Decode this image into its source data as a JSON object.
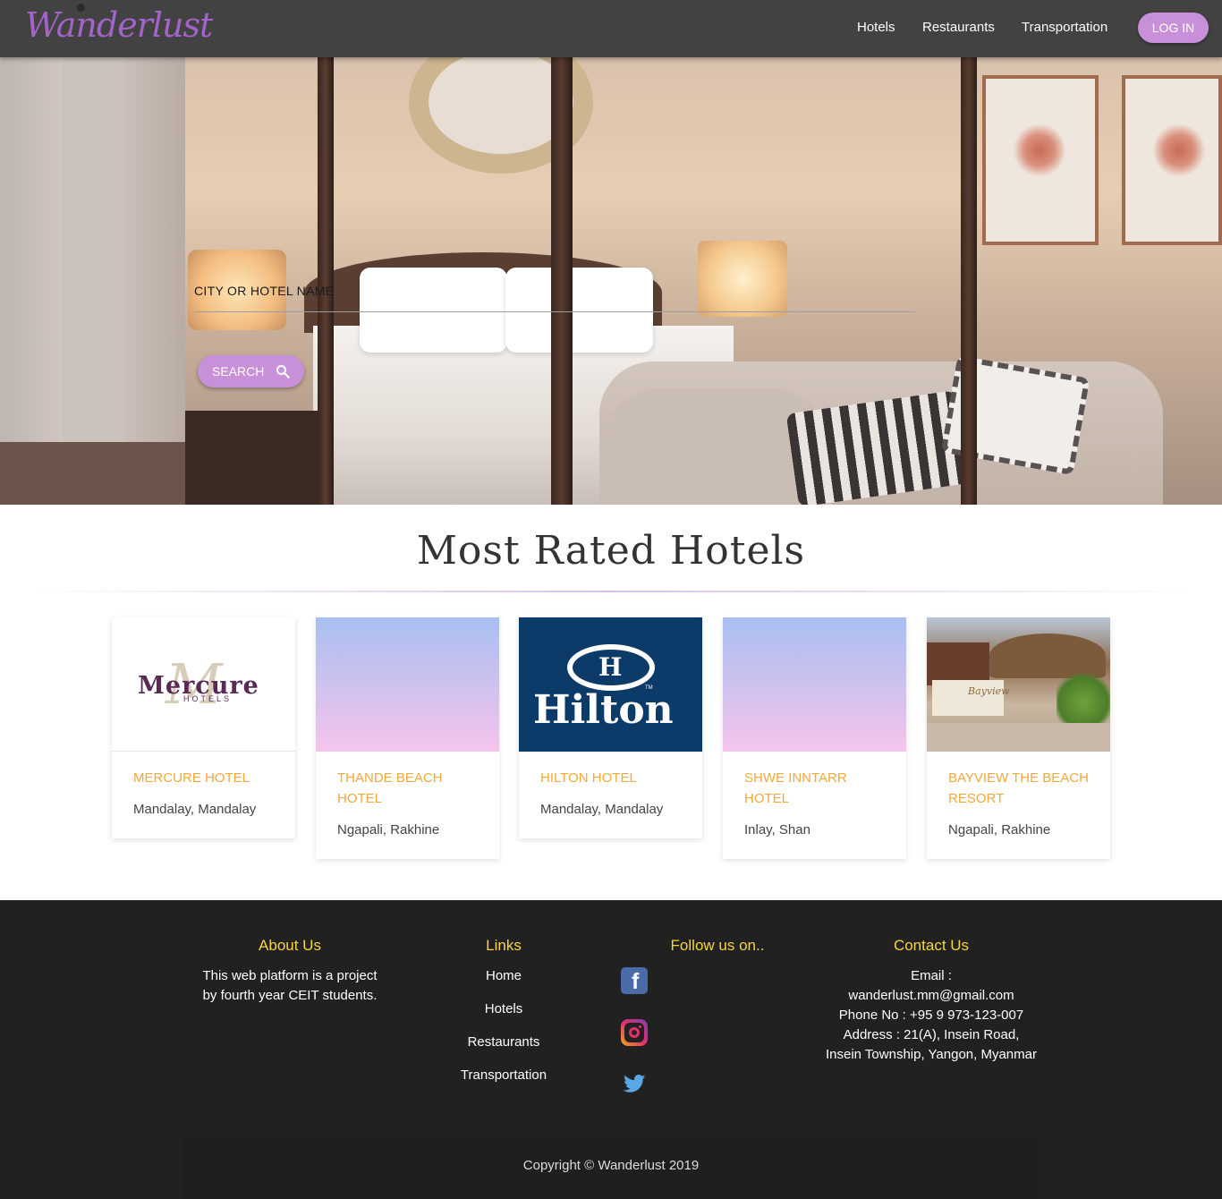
{
  "navbar": {
    "logo": "Wanderlust",
    "links": [
      {
        "label": "Hotels"
      },
      {
        "label": "Restaurants"
      },
      {
        "label": "Transportation"
      }
    ],
    "login_label": "LOG IN",
    "accent_color": "#c890d8",
    "background_color": "#424242"
  },
  "hero": {
    "search_placeholder": "CITY OR HOTEL NAME",
    "search_value": "",
    "search_button_label": "SEARCH",
    "search_icon": "search-icon"
  },
  "hotels_section": {
    "title": "Most Rated Hotels",
    "hotels": [
      {
        "name": "MERCURE HOTEL",
        "location": "Mandalay, Mandalay",
        "logo_text": "Mercure",
        "logo_sub": "HOTELS"
      },
      {
        "name": "THANDE BEACH HOTEL",
        "location": "Ngapali, Rakhine"
      },
      {
        "name": "HILTON HOTEL",
        "location": "Mandalay, Mandalay",
        "logo_text": "Hilton",
        "logo_mark": "H",
        "logo_tm": "TM"
      },
      {
        "name": "SHWE INNTARR HOTEL",
        "location": "Inlay, Shan"
      },
      {
        "name": "BAYVIEW THE BEACH RESORT",
        "location": "Ngapali, Rakhine",
        "sign_text": "Bayview"
      }
    ],
    "title_color": "#f2a93b"
  },
  "footer": {
    "about": {
      "heading": "About Us",
      "text": "This web platform is a project by fourth year CEIT students."
    },
    "links": {
      "heading": "Links",
      "items": [
        "Home",
        "Hotels",
        "Restaurants",
        "Transportation"
      ]
    },
    "follow": {
      "heading": "Follow us on..",
      "icons": [
        "facebook-icon",
        "instagram-icon",
        "twitter-icon"
      ]
    },
    "contact": {
      "heading": "Contact Us",
      "email_label": "Email :",
      "email": "wanderlust.mm@gmail.com",
      "phone": "Phone No : +95 9 973-123-007",
      "address": "Address : 21(A), Insein Road, Insein Township, Yangon, Myanmar"
    },
    "copyright": "Copyright © Wanderlust 2019",
    "heading_color": "#f7d43f"
  }
}
